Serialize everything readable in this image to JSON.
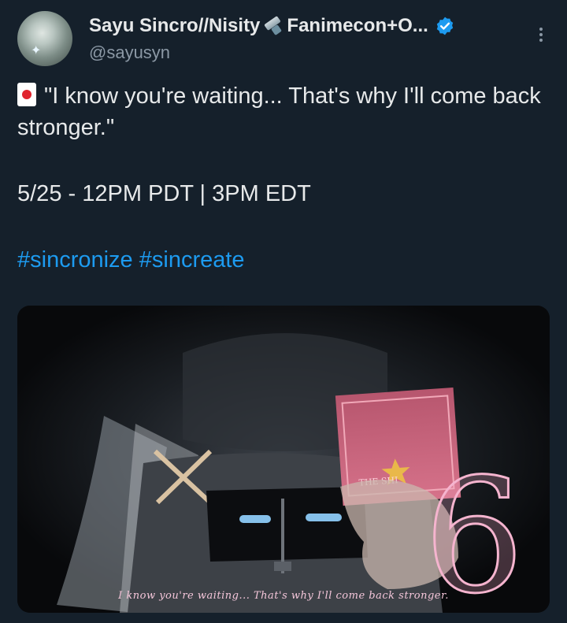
{
  "author": {
    "display_name_part1": "Sayu Sincro//Nisity",
    "display_name_part2": "Fanimecon+O...",
    "handle": "@sayusyn",
    "verified": true,
    "emoji_icon": "nut-and-bolt-icon"
  },
  "tweet": {
    "line1": "\"I know you're waiting... That's why I'll come back stronger.\"",
    "schedule": "5/25 - 12PM PDT | 3PM EDT",
    "hashtags": [
      "#sincronize",
      "#sincreate"
    ]
  },
  "media": {
    "caption": "I know you're waiting... That's why I'll come back stronger.",
    "card_label": "THE SHI",
    "big_number": "6"
  },
  "colors": {
    "background": "#15202b",
    "text": "#e7e9ea",
    "secondary": "#8b98a5",
    "link": "#1d9bf0",
    "verified": "#1d9bf0"
  }
}
